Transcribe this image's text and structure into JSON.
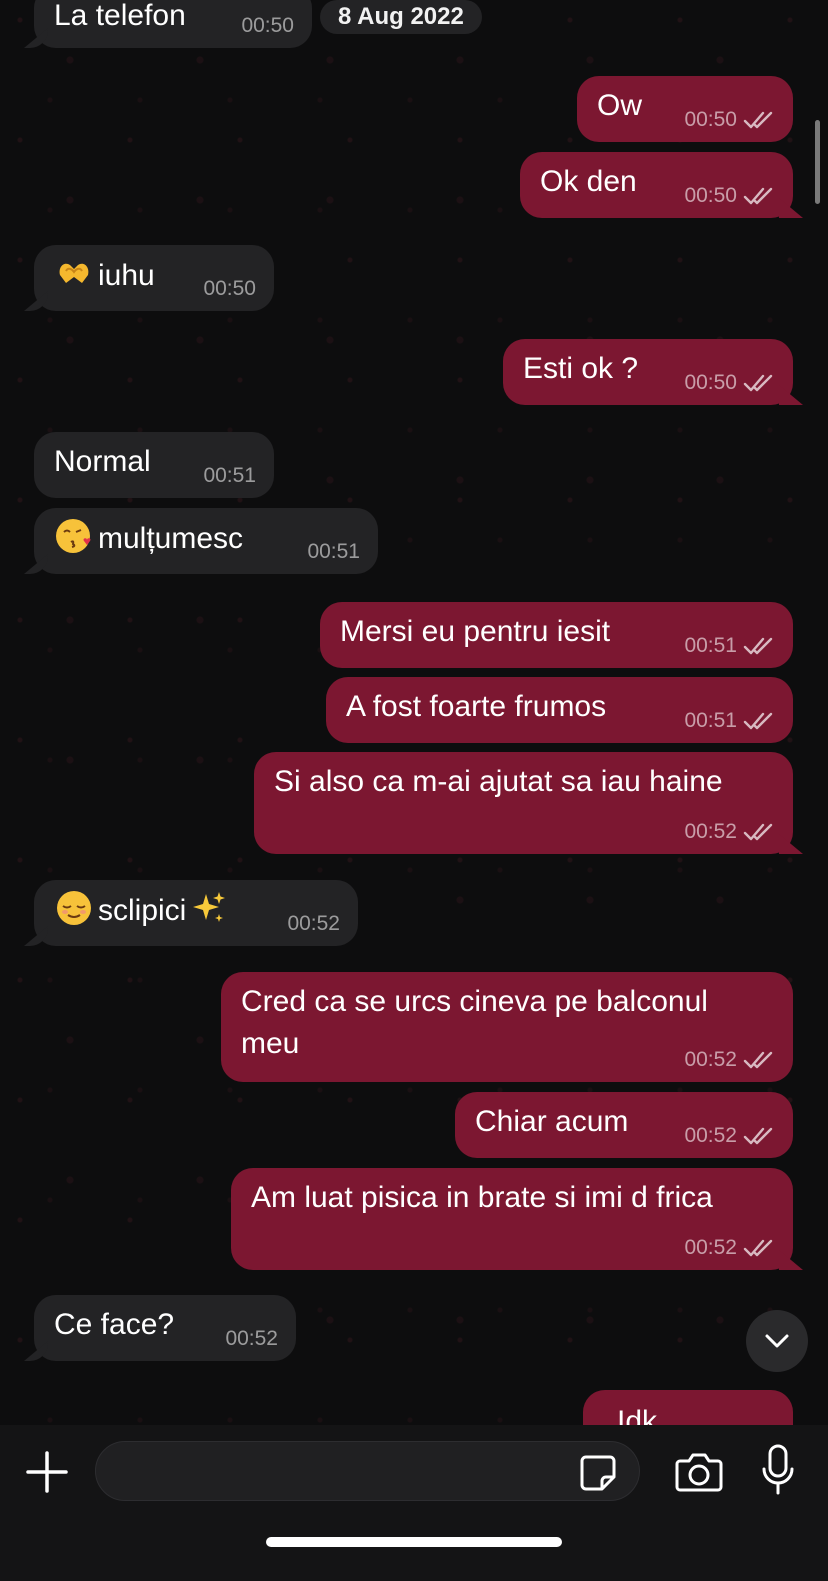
{
  "date_pill": "8 Aug 2022",
  "composer": {
    "placeholder": ""
  },
  "messages": [
    {
      "dir": "in",
      "text": "La telefon",
      "time": "00:50"
    },
    {
      "dir": "out",
      "text": "Ow",
      "time": "00:50"
    },
    {
      "dir": "out",
      "text": "Ok den",
      "time": "00:50"
    },
    {
      "dir": "in",
      "emoji": "heart-hands",
      "text": "iuhu",
      "time": "00:50"
    },
    {
      "dir": "out",
      "text": "Esti ok ?",
      "time": "00:50"
    },
    {
      "dir": "in",
      "text": "Normal",
      "time": "00:51"
    },
    {
      "dir": "in",
      "emoji": "kissing-face",
      "text": "mulțumesc",
      "time": "00:51"
    },
    {
      "dir": "out",
      "text": "Mersi eu pentru iesit",
      "time": "00:51"
    },
    {
      "dir": "out",
      "text": "A fost foarte frumos",
      "time": "00:51"
    },
    {
      "dir": "out",
      "text": "Si also ca m-ai ajutat sa iau haine",
      "time": "00:52"
    },
    {
      "dir": "in",
      "emoji": "relieved-face",
      "text": "sclipici",
      "emoji_after": "sparkles",
      "time": "00:52"
    },
    {
      "dir": "out",
      "text_line1": "Cred ca se urcs cineva pe balconul",
      "text_line2": "meu",
      "time": "00:52"
    },
    {
      "dir": "out",
      "text": "Chiar acum",
      "time": "00:52"
    },
    {
      "dir": "out",
      "text": "Am luat pisica in brate si imi d frica",
      "time": "00:52"
    },
    {
      "dir": "in",
      "text": "Ce face?",
      "time": "00:52"
    },
    {
      "dir": "out",
      "text": "Idk",
      "time": ""
    }
  ],
  "icons": {
    "read_receipt": "double-check-icon",
    "plus": "plus-icon",
    "sticker": "sticker-icon",
    "camera": "camera-icon",
    "mic": "microphone-icon",
    "scroll_down": "chevron-down-icon"
  },
  "colors": {
    "outgoing_bubble": "#7c1731",
    "incoming_bubble": "#232325",
    "background": "#0e0e0f"
  }
}
